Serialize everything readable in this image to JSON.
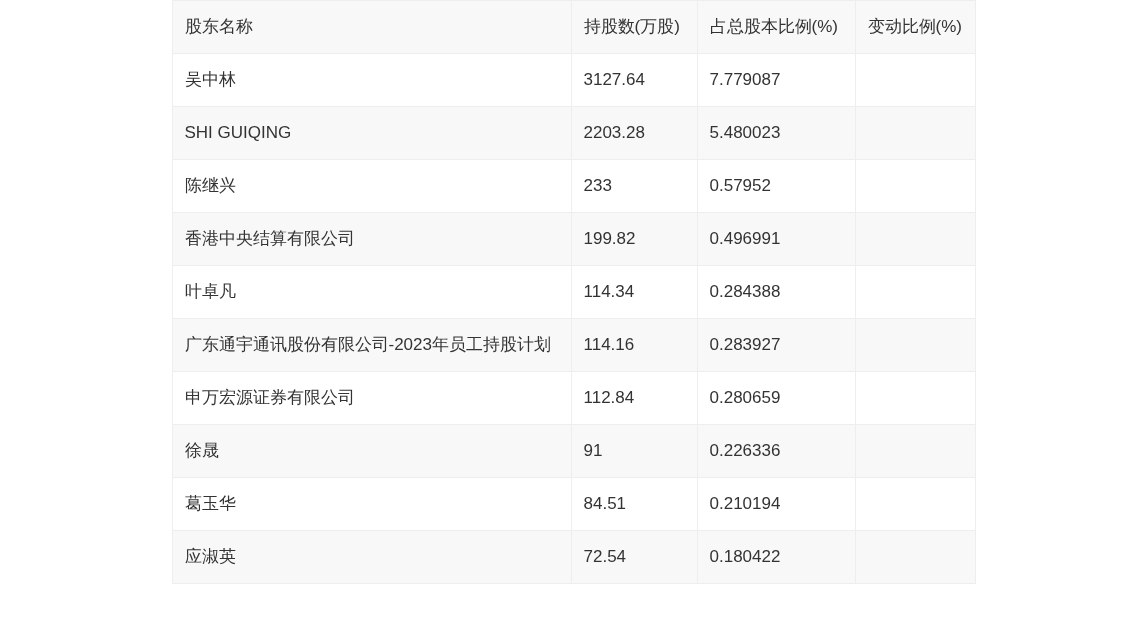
{
  "table": {
    "columns": [
      "股东名称",
      "持股数(万股)",
      "占总股本比例(%)",
      "变动比例(%)"
    ],
    "rows": [
      [
        "吴中林",
        "3127.64",
        "7.779087"
      ],
      [
        "SHI GUIQING",
        "2203.28",
        "5.480023"
      ],
      [
        "陈继兴",
        "233",
        "0.57952"
      ],
      [
        "香港中央结算有限公司",
        "199.82",
        "0.496991"
      ],
      [
        "叶卓凡",
        "114.34",
        "0.284388"
      ],
      [
        "广东通宇通讯股份有限公司-2023年员工持股计划",
        "114.16",
        "0.283927"
      ],
      [
        "申万宏源证券有限公司",
        "112.84",
        "0.280659"
      ],
      [
        "徐晟",
        "91",
        "0.226336"
      ],
      [
        "葛玉华",
        "84.51",
        "0.210194"
      ],
      [
        "应淑英",
        "72.54",
        "0.180422"
      ]
    ]
  }
}
